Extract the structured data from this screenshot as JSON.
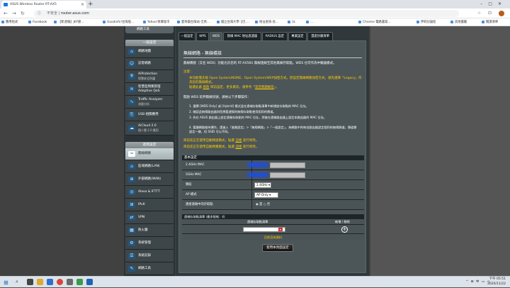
{
  "browser": {
    "tab_title": "ASUS Wireless Router RT-AX5",
    "url_prefix": "不安全 | ",
    "url": "router.asus.com",
    "bookmarks": [
      "應用程式",
      "Facebook",
      "【新週報】JKF捷...",
      "Goodinfo!台灣股...",
      "Yahoo!奇摩股市",
      "愛奇藝台灣站-全頁...",
      "國立台灣大學【巴....",
      "地址查詢-長...",
      "3c",
      "...",
      "Chrome 電路書寫...",
      "伊莉討論區",
      "其他書籤",
      "閱讀清單"
    ]
  },
  "sidebar": {
    "top_item": "網路工具",
    "general_title": "一般設定",
    "advanced_title": "進階設定",
    "items": [
      {
        "label": "網路地圖",
        "icon": "⌂"
      },
      {
        "label": "訪客網路",
        "icon": "☺"
      },
      {
        "label": "AiProtection",
        "sub": "智慧安全防護",
        "icon": "⛨"
      },
      {
        "label": "智慧型頻寬管理 Adaptive QoS",
        "icon": "≋"
      },
      {
        "label": "Traffic Analyzer",
        "sub": "流量分析",
        "icon": "∿"
      },
      {
        "label": "USB 相關應用",
        "icon": "⎘"
      },
      {
        "label": "AiCloud 2.0",
        "sub": "個人雲 2.0 應用",
        "icon": "☁"
      }
    ],
    "advanced": [
      {
        "label": "無線網路",
        "icon": "≈"
      },
      {
        "label": "區域網路(LAN)",
        "icon": "⌂"
      },
      {
        "label": "外部網路(WAN)",
        "icon": "⊕"
      },
      {
        "label": "Alexa & IFTTT",
        "icon": "◎"
      },
      {
        "label": "IPv6",
        "icon": "⊞"
      },
      {
        "label": "VPN",
        "icon": "⇄"
      },
      {
        "label": "防火牆",
        "icon": "▦"
      },
      {
        "label": "系統管理",
        "icon": "⚙"
      },
      {
        "label": "系統記錄",
        "icon": "☰"
      },
      {
        "label": "網路工具",
        "icon": "✎"
      }
    ]
  },
  "tabs": [
    "一般設定",
    "WPS",
    "WDS",
    "無線 MAC 地址過濾器",
    "RADIUS 設定",
    "專業設定",
    "漫遊封鎖清單"
  ],
  "content": {
    "title": "無線網路 - 無線橋接",
    "desc": "無線橋接（又名 WDS）功能允許您的 RT-AX56U 無線連線至其他無線存取點。WDS 也可作為中繼器模式。",
    "note_label": "注意：",
    "note1": "本功能僅支援 Open System/NONE、Open System/WEP加密方式。欲設定無線網路加密方式，請先選擇「Legacy」作為您的無線模式。",
    "note2_a": "點選此處 ",
    "note2_b": "修改",
    "note2_c": " 目前設定，更多資訊，請參考「",
    "note2_link": "常見問題解答",
    "note2_d": "」。",
    "steps_title": "開啟 WDS 延伸無線訊號，請依以下步驟操作：",
    "steps": [
      "1. 選擇 [WDS Only] 或 [Hybrid] 模式並在遠端存取點清單中新增該存取點的 MAC 位址。",
      "2. 確認此無線路由器與您想要連線的無線存取點使用相同的頻道。",
      "3. 先在 ASUS 路由器上設定遠端存取點的 MAC 位址，然後在遠端路由器上設定本路由器的 MAC 位址。",
      "4. 要讓網路維持運作，請進入「進階設定」>「無線網路」>「一般設定」，為網路中的每台路由器設定相同的無線頻道，頻道需設定一樣，但 SSID 可以不同。"
    ],
    "cur_channel_a": "目前您正在使用自動頻道模式，點選 ",
    "cur_channel_link": "這裡",
    "cur_channel_b": " 進行修改。",
    "cur_band_a": "目前您正在使用自動頻寬模式，點選 ",
    "cur_band_link": "這裡",
    "cur_band_b": " 進行修改。"
  },
  "basic": {
    "header": "基本設定",
    "mac24_label": "2.4GHz MAC",
    "mac5_label": "5GHz MAC",
    "band_label": "頻段",
    "band_value": "2.4GHz",
    "ap_label": "AP 模式",
    "ap_value": "AP Only",
    "remote_label": "連接遠端中的存取點",
    "yes": "是",
    "no": "否"
  },
  "remote_list": {
    "header": "遠端存取點清單 (最多限制：4)",
    "col_mac": "遠端存取點清單",
    "col_action": "新增 / 移除",
    "no_data": "目前沒有資料",
    "apply": "套用本頁面設定"
  },
  "taskbar": {
    "time": "下午 05:51",
    "date": "2020/11/22",
    "tray": "^ ⊞ 中 ▭ ◁"
  }
}
